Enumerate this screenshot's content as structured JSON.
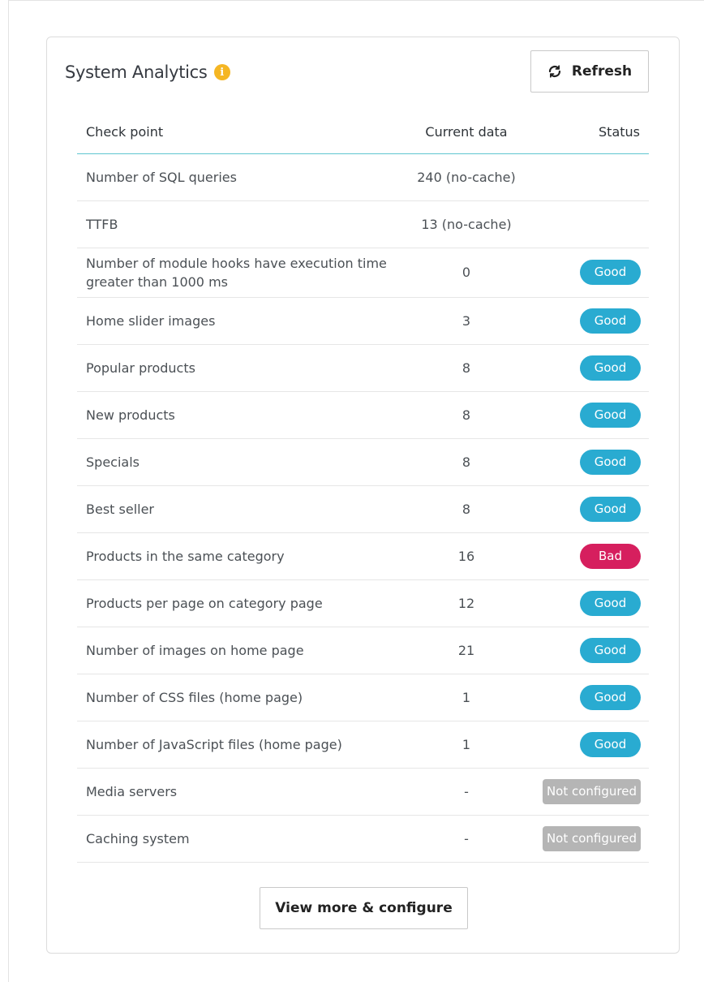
{
  "panel": {
    "title": "System Analytics",
    "info_icon": "i",
    "refresh_label": "Refresh",
    "refresh_icon": "⟳"
  },
  "table": {
    "headers": {
      "check_point": "Check point",
      "current_data": "Current data",
      "status": "Status"
    },
    "rows": [
      {
        "check": "Number of SQL queries",
        "data": "240 (no-cache)",
        "status": "",
        "status_type": "none-empty"
      },
      {
        "check": "TTFB",
        "data": "13 (no-cache)",
        "status": "",
        "status_type": "none-empty"
      },
      {
        "check": "Number of module hooks have execution time greater than 1000 ms",
        "data": "0",
        "status": "Good",
        "status_type": "good"
      },
      {
        "check": "Home slider images",
        "data": "3",
        "status": "Good",
        "status_type": "good"
      },
      {
        "check": "Popular products",
        "data": "8",
        "status": "Good",
        "status_type": "good"
      },
      {
        "check": "New products",
        "data": "8",
        "status": "Good",
        "status_type": "good"
      },
      {
        "check": "Specials",
        "data": "8",
        "status": "Good",
        "status_type": "good"
      },
      {
        "check": "Best seller",
        "data": "8",
        "status": "Good",
        "status_type": "good"
      },
      {
        "check": "Products in the same category",
        "data": "16",
        "status": "Bad",
        "status_type": "bad"
      },
      {
        "check": "Products per page on category page",
        "data": "12",
        "status": "Good",
        "status_type": "good"
      },
      {
        "check": "Number of images on home page",
        "data": "21",
        "status": "Good",
        "status_type": "good"
      },
      {
        "check": "Number of CSS files (home page)",
        "data": "1",
        "status": "Good",
        "status_type": "good"
      },
      {
        "check": "Number of JavaScript files (home page)",
        "data": "1",
        "status": "Good",
        "status_type": "good"
      },
      {
        "check": "Media servers",
        "data": "-",
        "status": "Not configured",
        "status_type": "none"
      },
      {
        "check": "Caching system",
        "data": "-",
        "status": "Not configured",
        "status_type": "none"
      }
    ]
  },
  "footer": {
    "view_more_label": "View more & configure"
  },
  "colors": {
    "good": "#29abd1",
    "bad": "#d61f5e",
    "not_configured": "#b5b5b5",
    "info": "#f5b623",
    "header_rule": "#5fc5d1"
  }
}
